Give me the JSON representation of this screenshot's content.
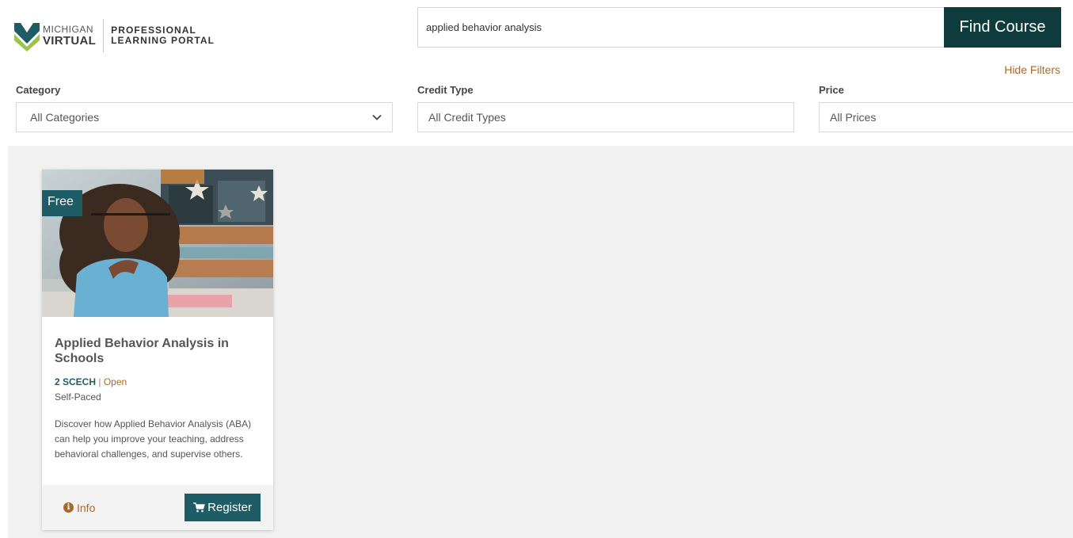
{
  "logo": {
    "brand_line1": "MICHIGAN",
    "brand_line2": "VIRTUAL",
    "portal_line1": "PROFESSIONAL",
    "portal_line2": "LEARNING PORTAL"
  },
  "search": {
    "value": "applied behavior analysis",
    "button_label": "Find Course"
  },
  "hide_filters_label": "Hide Filters",
  "filters": [
    {
      "label": "Category",
      "value": "All Categories"
    },
    {
      "label": "Credit Type",
      "value": "All Credit Types"
    },
    {
      "label": "Price",
      "value": "All Prices"
    }
  ],
  "course": {
    "badge": "Free",
    "title": "Applied Behavior Analysis in Schools",
    "credits": "2 SCECH",
    "separator": "|",
    "status": "Open",
    "pace": "Self-Paced",
    "description": "Discover how Applied Behavior Analysis (ABA) can help you improve your teaching, address behavioral challenges, and supervise others.",
    "info_label": "Info",
    "register_label": "Register"
  },
  "colors": {
    "brand_dark": "#0e3b3c",
    "teal": "#1f5d66",
    "accent_orange": "#a86a2b",
    "results_bg": "#f1f1f1"
  },
  "icons": [
    "michigan-virtual-logo-icon",
    "chevron-down-icon",
    "info-icon",
    "cart-icon"
  ]
}
